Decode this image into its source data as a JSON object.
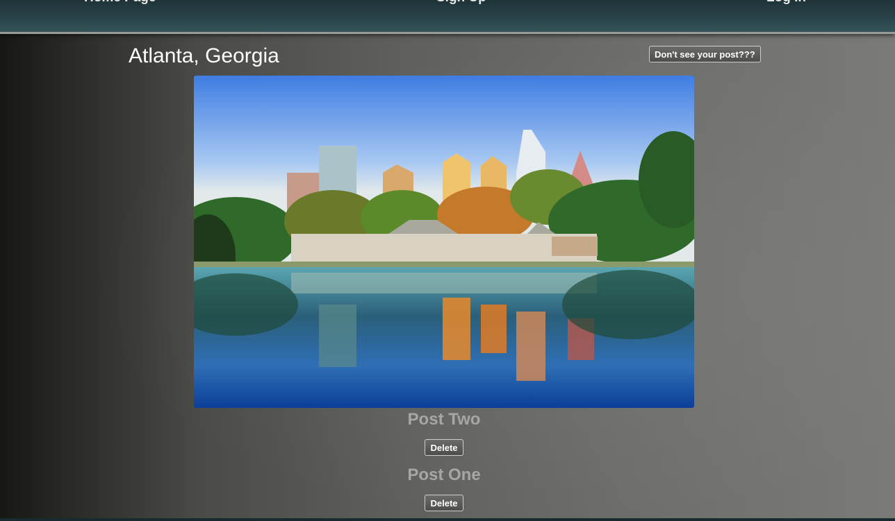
{
  "nav": {
    "home_label": "Home Page",
    "signup_label": "Sign Up",
    "login_label": "Log In"
  },
  "page": {
    "title": "Atlanta, Georgia",
    "help_button_label": "Don't see your post???"
  },
  "posts": [
    {
      "title": "Post Two",
      "delete_label": "Delete"
    },
    {
      "title": "Post One",
      "delete_label": "Delete"
    }
  ],
  "colors": {
    "navbar": "#29434a",
    "title_text": "#ffffff",
    "post_title_text": "#a6a6a3"
  }
}
